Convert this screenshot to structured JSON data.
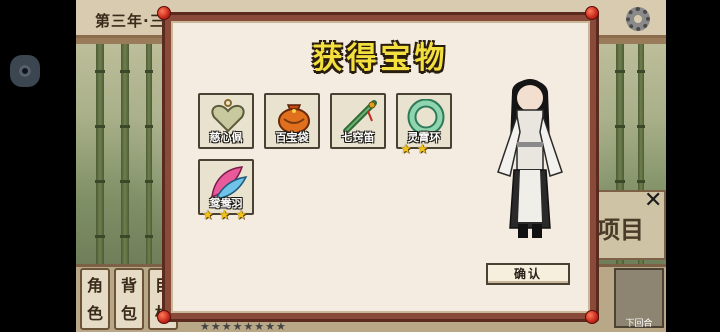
{
  "hud": {
    "year_label": "第三年·三",
    "settings_icon": "gear-icon",
    "side_label": "项目",
    "close_icon": "close-icon",
    "menu": [
      {
        "label": "角\n色"
      },
      {
        "label": "背\n包"
      },
      {
        "label": "目\n标"
      }
    ],
    "next_turn_label": "下回合",
    "rating_stars": "★★★★★★★★"
  },
  "dialog": {
    "title": "获得宝物",
    "confirm_label": "确认",
    "items": [
      {
        "name": "慈心佩",
        "icon": "heart-jade-pendant-icon",
        "stars": ""
      },
      {
        "name": "百宝袋",
        "icon": "treasure-pouch-icon",
        "stars": ""
      },
      {
        "name": "七窍笛",
        "icon": "jade-flute-icon",
        "stars": ""
      },
      {
        "name": "灵霄环",
        "icon": "jade-ring-icon",
        "stars": "★★"
      },
      {
        "name": "鸳鸯羽",
        "icon": "feathers-icon",
        "stars": "★★★"
      }
    ]
  },
  "colors": {
    "title": "#f3df3d",
    "dialog_bg": "#f4ece0",
    "frame": "#8a4a3a",
    "star": "#f1c21b"
  }
}
